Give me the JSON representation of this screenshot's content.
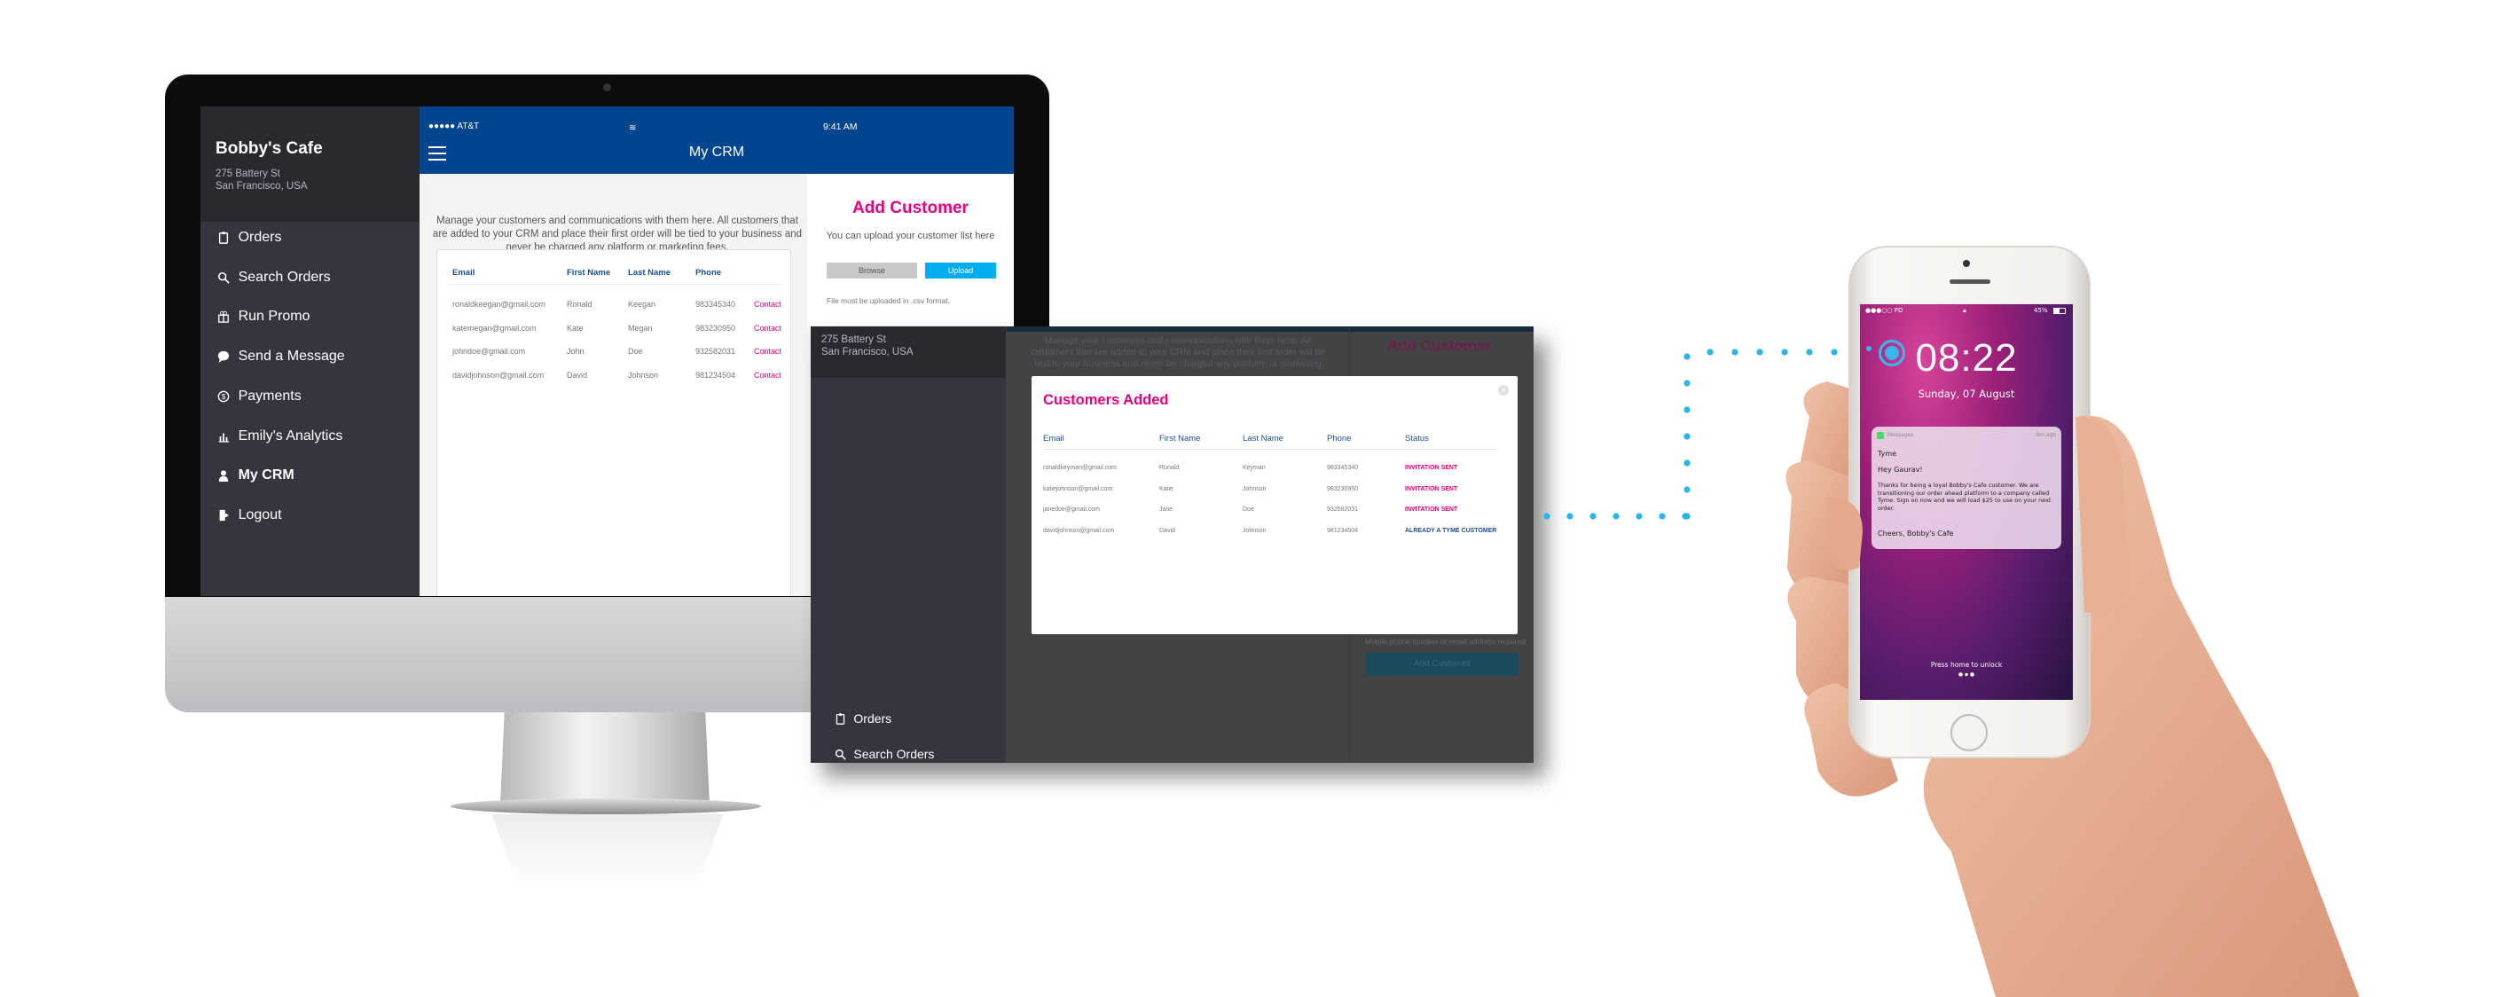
{
  "colors": {
    "accent_pink": "#e6007e",
    "header_blue": "#01458e",
    "upload_blue": "#00aeef",
    "sidebar": "#36353f",
    "status_blue": "#1b4f93",
    "connector_dots": "#29b6e6"
  },
  "sidebar": {
    "business_name": "Bobby's Cafe",
    "address_line1": "275 Battery St",
    "address_line2": "San Francisco, USA",
    "items": [
      {
        "label": "Orders",
        "icon": "clipboard-icon"
      },
      {
        "label": "Search Orders",
        "icon": "search-icon"
      },
      {
        "label": "Run Promo",
        "icon": "gift-icon"
      },
      {
        "label": "Send a Message",
        "icon": "chat-bubble-icon"
      },
      {
        "label": "Payments",
        "icon": "dollar-coin-icon"
      },
      {
        "label": "Emily's Analytics",
        "icon": "bar-chart-icon"
      },
      {
        "label": "My CRM",
        "icon": "user-icon",
        "active": true
      },
      {
        "label": "Logout",
        "icon": "logout-icon"
      }
    ]
  },
  "status_bar": {
    "carrier": "●●●●● AT&T",
    "time": "9:41 AM"
  },
  "header": {
    "title": "My CRM",
    "menu_icon": "hamburger-icon"
  },
  "main": {
    "intro": "Manage your customers and communications with them here. All customers that are added to your CRM and place their first order will be tied to your business and never be charged any platform or marketing fees.",
    "table": {
      "columns": [
        "Email",
        "First Name",
        "Last Name",
        "Phone"
      ],
      "rows": [
        {
          "email": "ronaldkeegan@gmail.com",
          "first": "Ronald",
          "last": "Keegan",
          "phone": "983345340",
          "action": "Contact"
        },
        {
          "email": "katemegan@gmail.com",
          "first": "Kate",
          "last": "Megan",
          "phone": "983230950",
          "action": "Contact"
        },
        {
          "email": "johndoe@gmail.com",
          "first": "John",
          "last": "Doe",
          "phone": "932582031",
          "action": "Contact"
        },
        {
          "email": "davidjohnson@gmail.com",
          "first": "David",
          "last": "Johnson",
          "phone": "981234504",
          "action": "Contact"
        }
      ]
    }
  },
  "add_customer": {
    "title": "Add Customer",
    "subtitle": "You can upload your customer list here",
    "browse_label": "Browse",
    "upload_label": "Upload",
    "note": "File must be uploaded in .csv format.",
    "required_note": "Mobile phone number or email address required",
    "submit_label": "Add Customer"
  },
  "modal": {
    "title": "Customers Added",
    "close_icon": "close-circle-icon",
    "columns": [
      "Email",
      "First Name",
      "Last Name",
      "Phone",
      "Status"
    ],
    "rows": [
      {
        "email": "ronaldkeyman@gmail.com",
        "first": "Ronald",
        "last": "Keyman",
        "phone": "983345340",
        "status": "INVITATION SENT",
        "status_type": "sent"
      },
      {
        "email": "katiejohnson@gmail.com",
        "first": "Katie",
        "last": "Johnson",
        "phone": "983230950",
        "status": "INVITATION SENT",
        "status_type": "sent"
      },
      {
        "email": "janedoe@gmail.com",
        "first": "Jane",
        "last": "Doe",
        "phone": "932582031",
        "status": "INVITATION SENT",
        "status_type": "sent"
      },
      {
        "email": "davidjohnson@gmail.com",
        "first": "David",
        "last": "Johnson",
        "phone": "981234504",
        "status": "ALREADY A TYME CUSTOMER",
        "status_type": "existing"
      }
    ]
  },
  "phone": {
    "carrier": "●●●○○ PD",
    "battery": "45%",
    "time": "08:22",
    "date": "Sunday, 07 August",
    "notification": {
      "app": "Messages",
      "age": "9m ago",
      "sender": "Tyme",
      "greeting": "Hey Gaurav!",
      "body": "Thanks for being a loyal Bobby's Cafe customer. We are transitioning our order ahead platform to a company called Tyme. Sign on now and we will load $25 to use on your next order.",
      "signoff": "Cheers, Bobby's Cafe"
    },
    "unlock_hint": "Press home to unlock"
  }
}
